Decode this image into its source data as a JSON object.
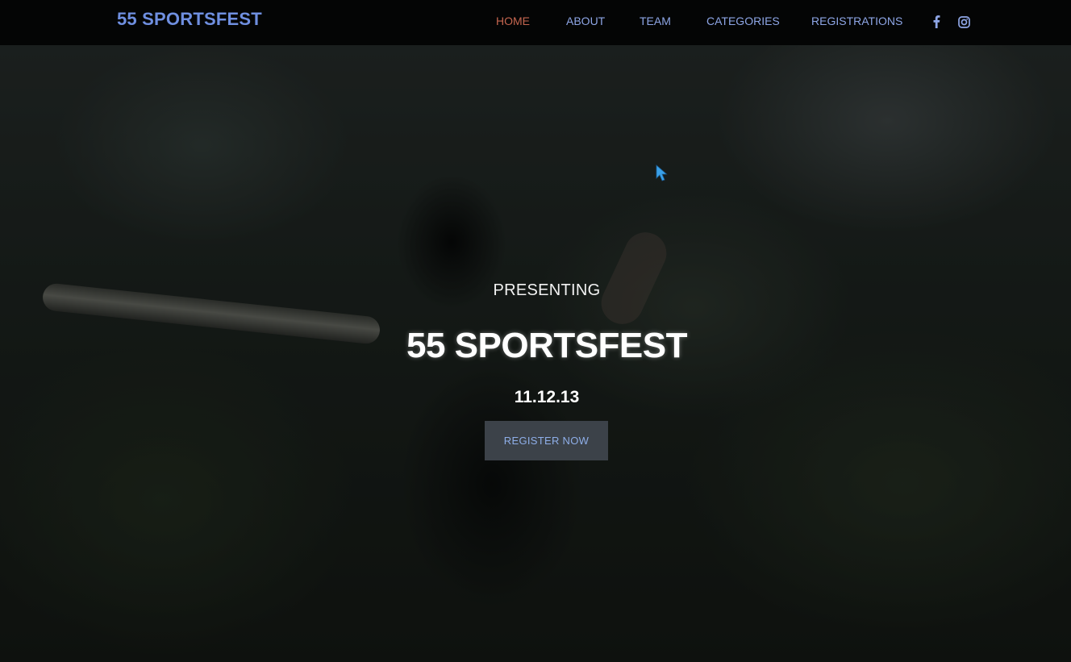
{
  "brand": "55 SPORTSFEST",
  "nav": {
    "items": [
      {
        "label": "HOME",
        "active": true
      },
      {
        "label": "ABOUT",
        "active": false
      },
      {
        "label": "TEAM",
        "active": false
      },
      {
        "label": "CATEGORIES",
        "active": false
      },
      {
        "label": "REGISTRATIONS",
        "active": false
      }
    ],
    "social": [
      "facebook-icon",
      "instagram-icon"
    ]
  },
  "hero": {
    "eyebrow": "PRESENTING",
    "title": "55 SPORTSFEST",
    "date": "11.12.13",
    "cta_label": "REGISTER NOW"
  },
  "colors": {
    "brand": "#6f8fe0",
    "nav_link": "#8ea6e6",
    "nav_active": "#c4654f",
    "navbar_bg": "#040505",
    "button_bg": "#3c4249",
    "button_text": "#8eaee8",
    "cursor": "#3aa0e8"
  }
}
